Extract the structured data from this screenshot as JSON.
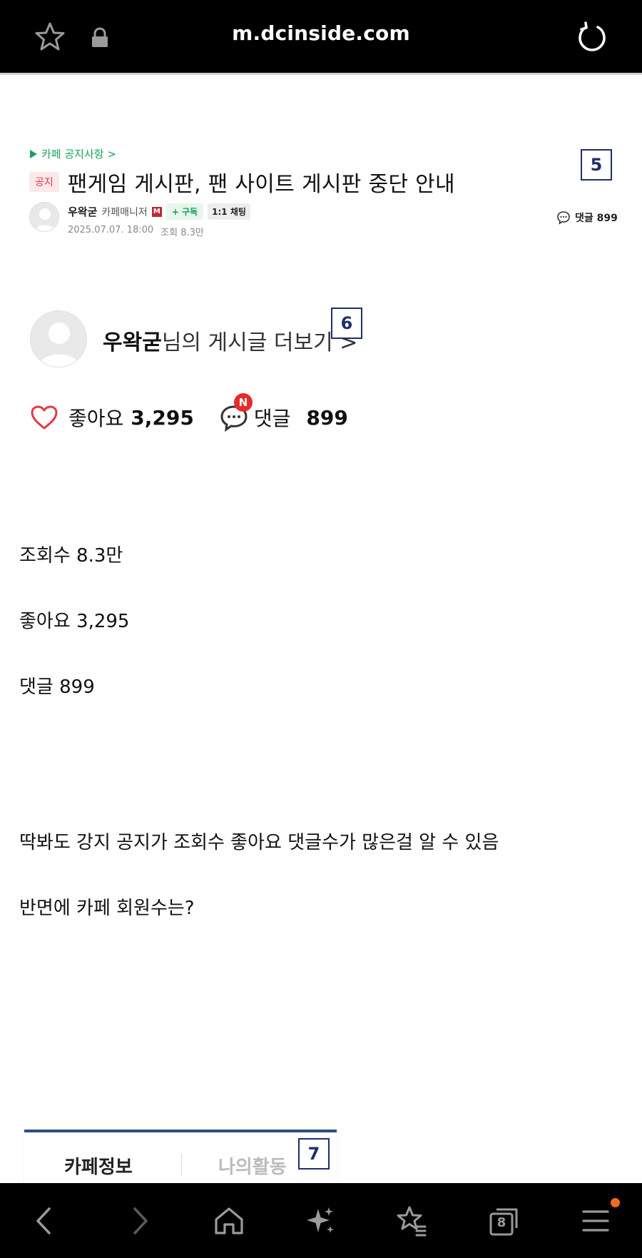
{
  "browser": {
    "url": "m.dcinside.com",
    "tab_count": "8"
  },
  "post": {
    "breadcrumb": "카페 공지사항 >",
    "notice_badge": "공지",
    "title": "팬게임 게시판, 팬 사이트 게시판 중단 안내",
    "author_name": "우왁굳",
    "author_role": "카페매니저",
    "manager_badge": "M",
    "subscribe_label": "+ 구독",
    "chat_label": "1:1 채팅",
    "date": "2025.07.07. 18:00",
    "views": "조회 8.3만",
    "comment_link": "댓글 899"
  },
  "markers": {
    "m5": "5",
    "m6": "6",
    "m7": "7"
  },
  "profile": {
    "name": "우왁굳",
    "suffix": "님의 게시글 더보기 >"
  },
  "stats": {
    "like_label": "좋아요",
    "like_count": "3,295",
    "new_badge": "N",
    "comment_label": "댓글",
    "comment_count": "899"
  },
  "body": {
    "line1": "조회수 8.3만",
    "line2": "좋아요 3,295",
    "line3": "댓글 899",
    "line4": "딱봐도 강지 공지가 조회수 좋아요 댓글수가 많은걸 알 수 있음",
    "line5": "반면에 카페 회원수는?"
  },
  "tabs": {
    "left": "카페정보",
    "right": "나의활동"
  },
  "icons": {
    "top": [
      "star-icon",
      "lock-icon",
      "reload-icon"
    ],
    "bottom": [
      "back-icon",
      "forward-icon",
      "home-icon",
      "sparkle-icon",
      "bookmark-star-icon",
      "tabs-icon",
      "menu-icon"
    ]
  },
  "colors": {
    "accent_green": "#19a35a",
    "notice_red": "#e5384a",
    "tab_blue": "#2a4f80",
    "new_red": "#e52b2b",
    "notification_orange": "#f26b1d"
  }
}
